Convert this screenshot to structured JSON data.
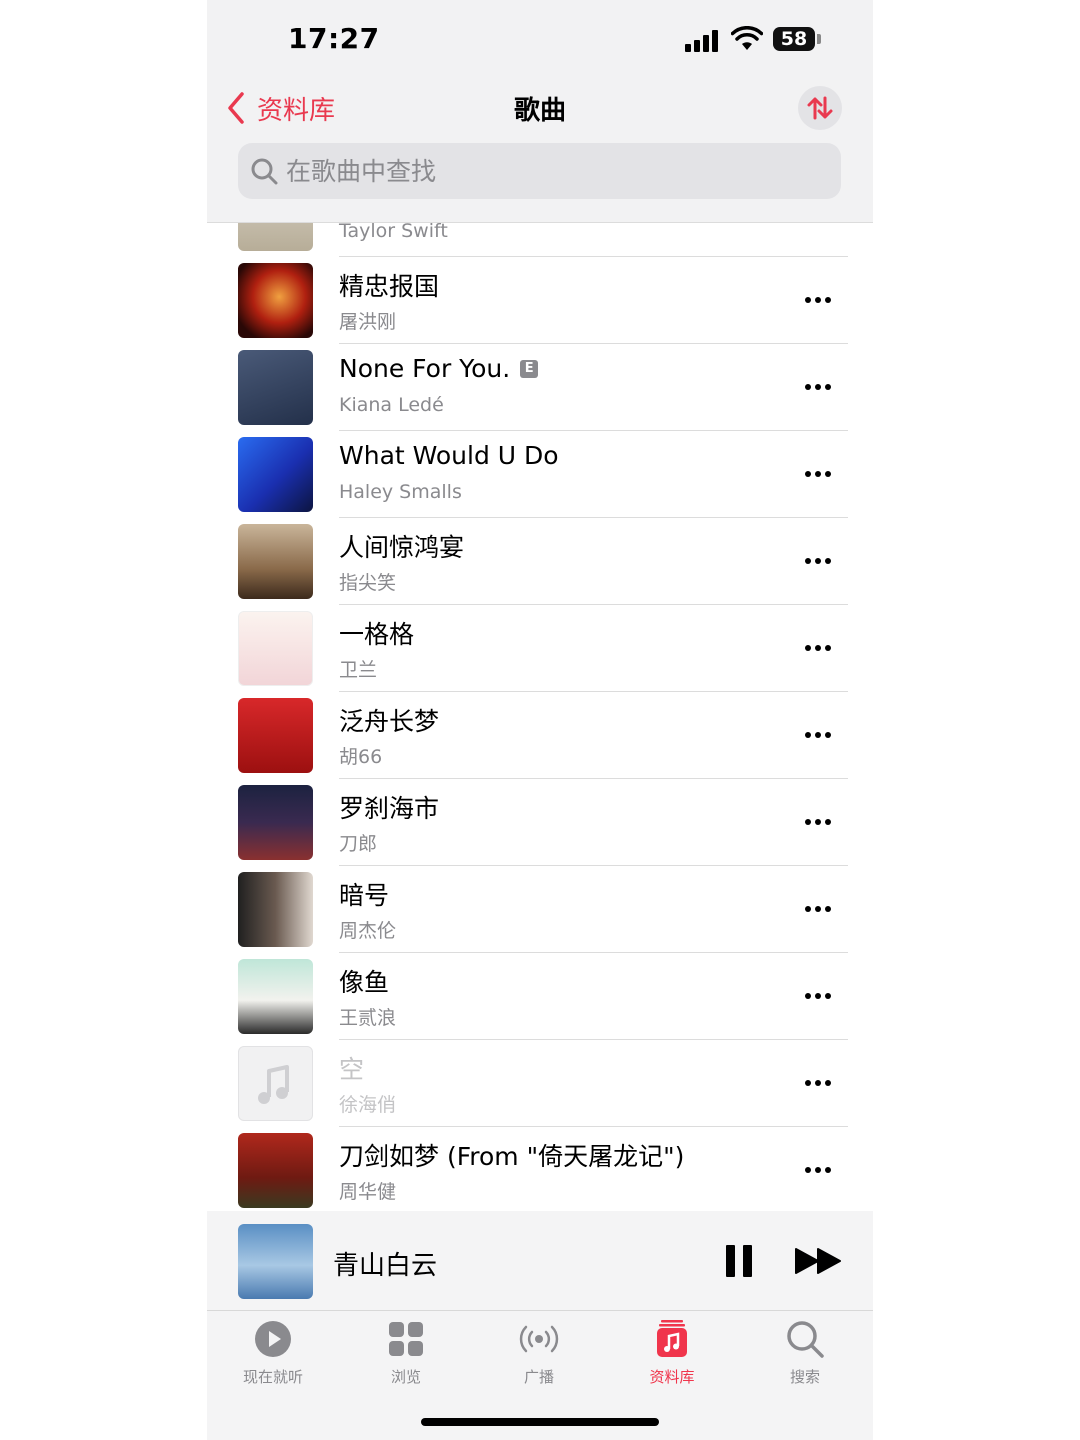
{
  "status_bar": {
    "time": "17:27",
    "battery": "58"
  },
  "nav": {
    "back_label": "资料库",
    "title": "歌曲"
  },
  "search": {
    "placeholder": "在歌曲中查找"
  },
  "songs": [
    {
      "title": "",
      "artist": "Taylor Swift"
    },
    {
      "title": "精忠报国",
      "artist": "屠洪刚"
    },
    {
      "title": "None For You.",
      "artist": "Kiana Ledé",
      "explicit_badge": "E"
    },
    {
      "title": "What Would U Do",
      "artist": "Haley Smalls"
    },
    {
      "title": "人间惊鸿宴",
      "artist": "指尖笑"
    },
    {
      "title": "一格格",
      "artist": "卫兰"
    },
    {
      "title": "泛舟长梦",
      "artist": "胡66"
    },
    {
      "title": "罗刹海市",
      "artist": "刀郎"
    },
    {
      "title": "暗号",
      "artist": "周杰伦"
    },
    {
      "title": "像鱼",
      "artist": "王贰浪"
    },
    {
      "title": "空",
      "artist": "徐海俏",
      "unavailable": true
    },
    {
      "title": "刀剑如梦 (From \"倚天屠龙记\")",
      "artist": "周华健"
    }
  ],
  "now_playing": {
    "title": "青山白云"
  },
  "tabs": [
    {
      "label": "现在就听",
      "icon": "play-circle-icon"
    },
    {
      "label": "浏览",
      "icon": "grid-icon"
    },
    {
      "label": "广播",
      "icon": "radio-icon"
    },
    {
      "label": "资料库",
      "icon": "library-icon",
      "active": true
    },
    {
      "label": "搜索",
      "icon": "search-icon"
    }
  ],
  "colors": {
    "accent": "#f0354c",
    "secondary_text": "#8a8a8e"
  }
}
